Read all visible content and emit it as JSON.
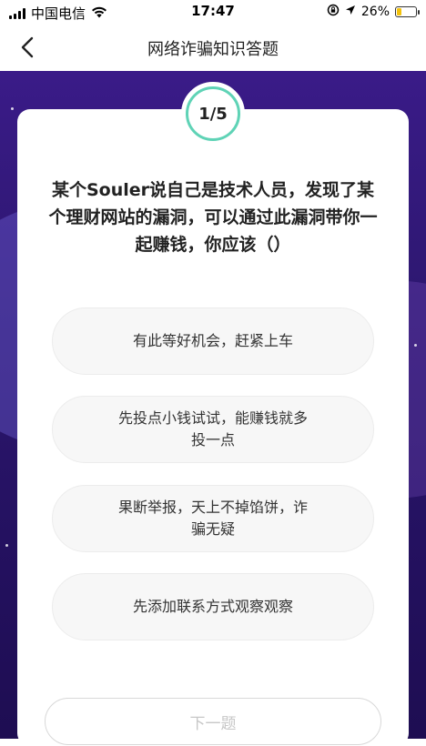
{
  "status_bar": {
    "carrier": "中国电信",
    "time": "17:47",
    "battery_percent": "26%",
    "battery_level": 0.26,
    "icons": [
      "signal-icon",
      "wifi-icon",
      "lock-rotation-icon",
      "location-arrow-icon",
      "battery-icon"
    ]
  },
  "nav": {
    "title": "网络诈骗知识答题",
    "back_icon": "chevron-left-icon"
  },
  "quiz": {
    "progress": "1/5",
    "question": "某个Souler说自己是技术人员，发现了某个理财网站的漏洞，可以通过此漏洞带你一起赚钱，你应该（）",
    "options": [
      "有此等好机会，赶紧上车",
      "先投点小钱试试，能赚钱就多投一点",
      "果断举报，天上不掉馅饼，诈骗无疑",
      "先添加联系方式观察观察"
    ],
    "next_label": "下一题"
  },
  "colors": {
    "background_top": "#3a1b88",
    "background_bottom": "#1e0d52",
    "ring_accent": "#5fd3b6",
    "option_bg": "#f7f7f7",
    "battery_fill": "#f3c20b"
  }
}
